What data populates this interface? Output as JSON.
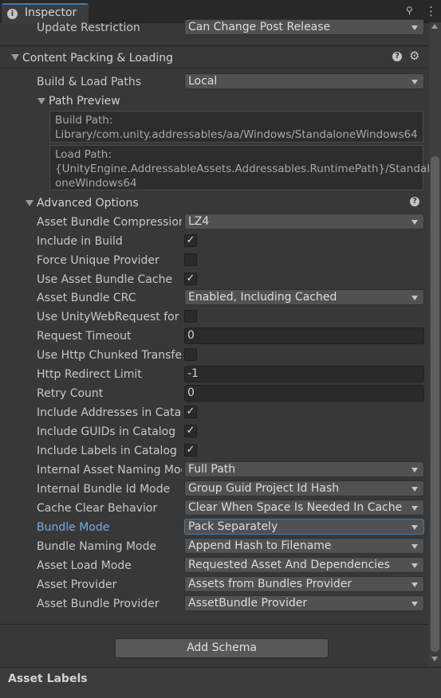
{
  "tab": {
    "title": "Inspector",
    "icon": "info-icon"
  },
  "top_row": {
    "label": "Update Restriction",
    "value": "Can Change Post Release"
  },
  "content_section": {
    "title": "Content Packing & Loading"
  },
  "build_load_paths": {
    "label": "Build & Load Paths",
    "value": "Local"
  },
  "path_preview": {
    "title": "Path Preview",
    "build_path_label": "Build Path:",
    "build_path": "Library/com.unity.addressables/aa/Windows/StandaloneWindows64",
    "load_path_label": "Load Path:",
    "load_path_1": "{UnityEngine.AddressableAssets.Addressables.RuntimePath}/Standal",
    "load_path_2": "oneWindows64"
  },
  "advanced": {
    "title": "Advanced Options",
    "compression": {
      "label": "Asset Bundle Compression",
      "value": "LZ4"
    },
    "include_in_build": {
      "label": "Include in Build",
      "checked": true
    },
    "force_unique_provider": {
      "label": "Force Unique Provider",
      "checked": false
    },
    "use_bundle_cache": {
      "label": "Use Asset Bundle Cache",
      "checked": true
    },
    "bundle_crc": {
      "label": "Asset Bundle CRC",
      "value": "Enabled, Including Cached"
    },
    "use_uwr": {
      "label": "Use UnityWebRequest for L",
      "checked": false
    },
    "request_timeout": {
      "label": "Request Timeout",
      "value": "0"
    },
    "http_chunked": {
      "label": "Use Http Chunked Transfer",
      "checked": false
    },
    "http_redirect": {
      "label": "Http Redirect Limit",
      "value": "-1"
    },
    "retry_count": {
      "label": "Retry Count",
      "value": "0"
    },
    "include_addresses": {
      "label": "Include Addresses in Catalo",
      "checked": true
    },
    "include_guids": {
      "label": "Include GUIDs in Catalog",
      "checked": true
    },
    "include_labels": {
      "label": "Include Labels in Catalog",
      "checked": true
    },
    "internal_asset_naming": {
      "label": "Internal Asset Naming Mode",
      "value": "Full Path"
    },
    "internal_bundle_id": {
      "label": "Internal Bundle Id Mode",
      "value": "Group Guid Project Id Hash"
    },
    "cache_clear": {
      "label": "Cache Clear Behavior",
      "value": "Clear When Space Is Needed In Cache"
    },
    "bundle_mode": {
      "label": "Bundle Mode",
      "value": "Pack Separately"
    },
    "bundle_naming": {
      "label": "Bundle Naming Mode",
      "value": "Append Hash to Filename"
    },
    "asset_load_mode": {
      "label": "Asset Load Mode",
      "value": "Requested Asset And Dependencies"
    },
    "asset_provider": {
      "label": "Asset Provider",
      "value": "Assets from Bundles Provider"
    },
    "bundle_provider": {
      "label": "Asset Bundle Provider",
      "value": "AssetBundle Provider"
    }
  },
  "add_schema_button": "Add Schema",
  "footer": {
    "title": "Asset Labels"
  },
  "glyphs": {
    "check": "✓",
    "help": "?",
    "gear": "⚙",
    "lock": "🔒",
    "menu": "⋮"
  },
  "colors": {
    "accent": "#3a79bb",
    "highlight_label": "#7ba9e4"
  }
}
